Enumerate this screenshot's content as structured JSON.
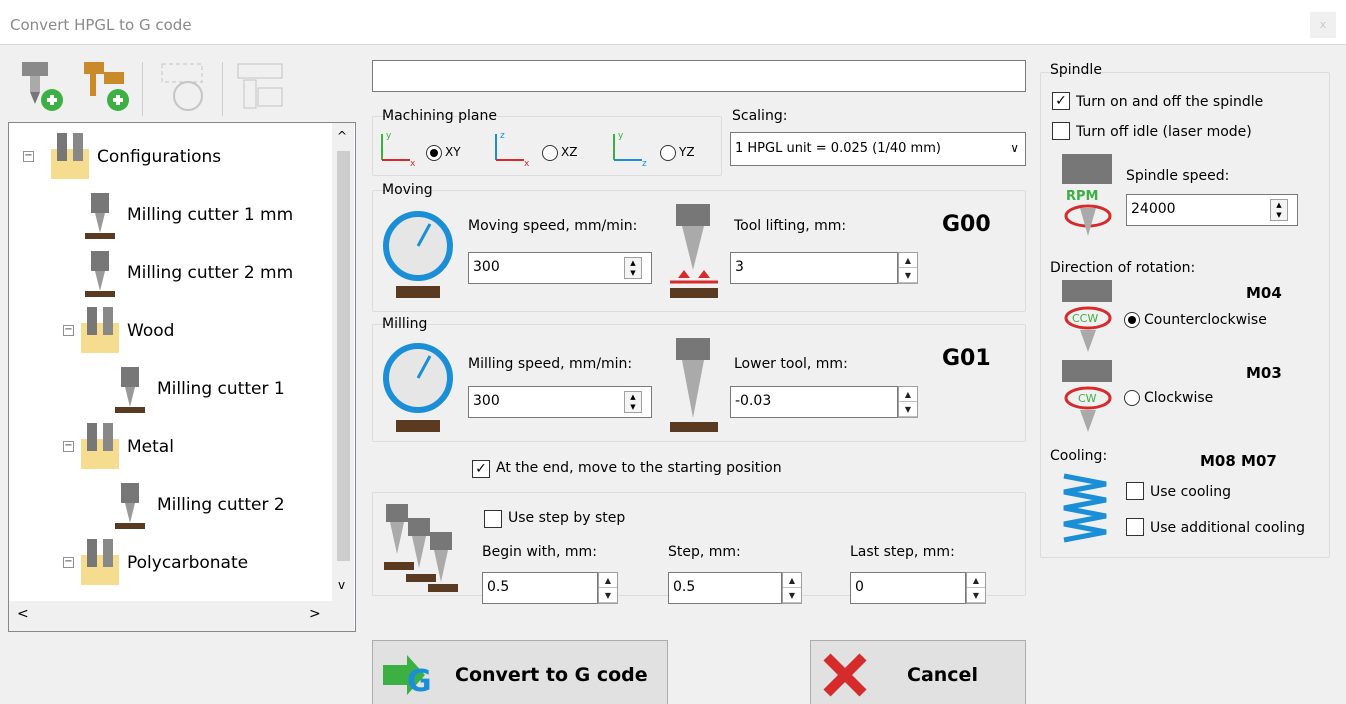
{
  "window": {
    "title": "Convert HPGL to G code",
    "close_label": "x"
  },
  "toolbar": {
    "buttons": [
      {
        "icon": "add-cutter-icon"
      },
      {
        "icon": "add-group-icon"
      },
      {
        "icon": "configure-icon"
      },
      {
        "icon": "settings-icon"
      }
    ]
  },
  "tree": {
    "items": [
      {
        "label": "Configurations"
      },
      {
        "label": "Milling cutter 1 mm"
      },
      {
        "label": "Milling cutter 2 mm"
      },
      {
        "label": "Wood"
      },
      {
        "label": "Milling cutter 1"
      },
      {
        "label": "Metal"
      },
      {
        "label": "Milling cutter 2"
      },
      {
        "label": "Polycarbonate"
      }
    ],
    "scroll_up": "^",
    "scroll_down": "v",
    "scroll_left": "<",
    "scroll_right": ">"
  },
  "plane": {
    "label": "Machining plane",
    "options": [
      "XY",
      "XZ",
      "YZ"
    ],
    "selected": "XY"
  },
  "scaling": {
    "label": "Scaling:",
    "value": "1 HPGL unit = 0.025 (1/40 mm)"
  },
  "moving": {
    "group": "Moving",
    "speed_label": "Moving speed, mm/min:",
    "speed_value": "300",
    "lift_label": "Tool lifting, mm:",
    "lift_value": "3",
    "code": "G00"
  },
  "milling": {
    "group": "Milling",
    "speed_label": "Milling speed, mm/min:",
    "speed_value": "300",
    "lower_label": "Lower tool, mm:",
    "lower_value": "-0.03",
    "code": "G01"
  },
  "end_move": {
    "label": "At the end, move to the starting position",
    "checked": true
  },
  "step": {
    "use_label": "Use step by step",
    "begin_label": "Begin with, mm:",
    "begin_value": "0.5",
    "step_label": "Step, mm:",
    "step_value": "0.5",
    "last_label": "Last step, mm:",
    "last_value": "0"
  },
  "spindle": {
    "group": "Spindle",
    "turn_on_off": "Turn on and off the spindle",
    "turn_off_idle": "Turn off idle (laser mode)",
    "speed_label": "Spindle speed:",
    "speed_value": "24000",
    "rpm_text": "RPM",
    "direction_label": "Direction of rotation:",
    "ccw_code": "M04",
    "ccw_label": "Counterclockwise",
    "ccw_icon_text": "CCW",
    "cw_code": "M03",
    "cw_label": "Clockwise",
    "cw_icon_text": "CW",
    "cooling_label": "Cooling:",
    "cooling_code": "M08 M07",
    "use_cooling": "Use cooling",
    "use_additional": "Use additional cooling"
  },
  "buttons": {
    "convert": "Convert to G code",
    "cancel": "Cancel"
  },
  "colors": {
    "accent_blue": "#1a8fd8",
    "green": "#3cb043",
    "red": "#d62b2b",
    "brown": "#5a3b22"
  }
}
